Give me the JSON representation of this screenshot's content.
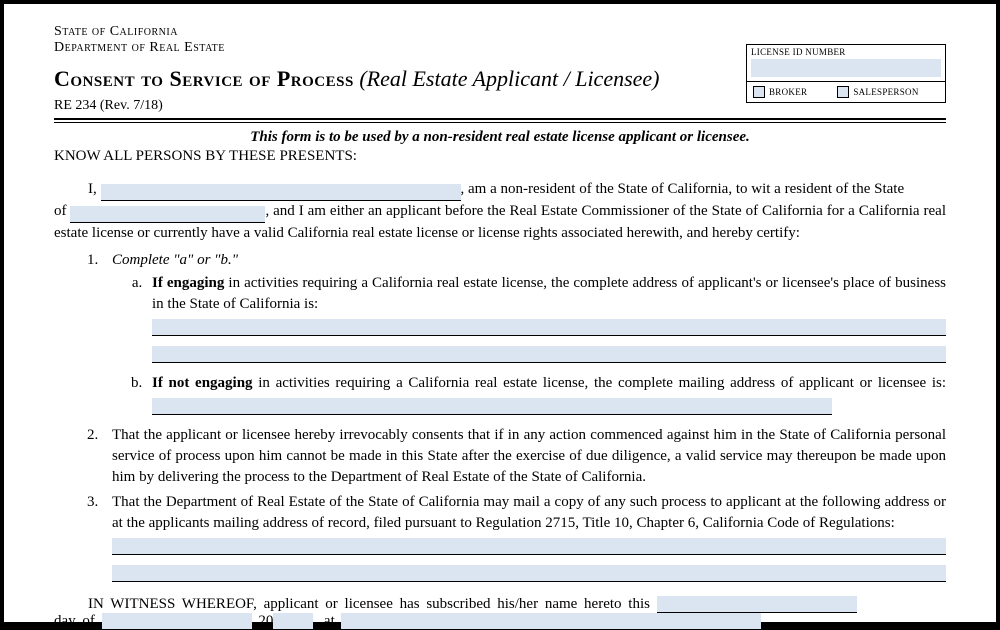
{
  "header": {
    "state": "State of California",
    "dept": "Department of Real Estate"
  },
  "title": {
    "main": "Consent to Service of Process",
    "sub": "(Real Estate Applicant / Licensee)"
  },
  "form_id": "RE 234 (Rev. 7/18)",
  "license_box": {
    "label": "LICENSE ID NUMBER",
    "broker": "BROKER",
    "salesperson": "SALESPERSON"
  },
  "intro": "This form is to be used by a non-resident real estate license applicant or licensee.",
  "know": "KNOW ALL PERSONS BY THESE PRESENTS:",
  "para": {
    "i": "I,",
    "p1_tail": ", am a non-resident of the State of California, to wit a resident of the State",
    "of": "of",
    "p2_tail": ", and I am either an applicant before the Real Estate Commissioner of the State of California for a California real estate license or currently have a valid California real estate license or license rights associated herewith, and hereby certify:"
  },
  "list": {
    "item1_instr": "Complete \"a\" or \"b.\"",
    "a_bold": "If engaging",
    "a_rest": " in activities requiring a California real estate license, the complete address of applicant's or licensee's place of business in the State of California is:",
    "b_bold": "If not engaging",
    "b_rest": " in activities requiring a California real estate license, the complete mailing address of applicant or licensee is:",
    "item2": "That the applicant or licensee hereby irrevocably consents that if in any action commenced against him in the State of California personal service of process upon him cannot be made in this State after the exercise of due diligence, a valid service may thereupon be made upon him by delivering the process to the Department of Real Estate of the State of California.",
    "item3": "That the Department of Real Estate of the State of California may mail a copy of any such process to applicant at the following address or at the applicants mailing address of record, filed pursuant to Regulation 2715, Title 10, Chapter 6, California Code of Regulations:"
  },
  "witness": {
    "lead": "IN WITNESS WHEREOF, applicant or licensee has subscribed his/her name hereto this",
    "day_of": "day of",
    "twenty": "20",
    "comma_at": ", at"
  }
}
